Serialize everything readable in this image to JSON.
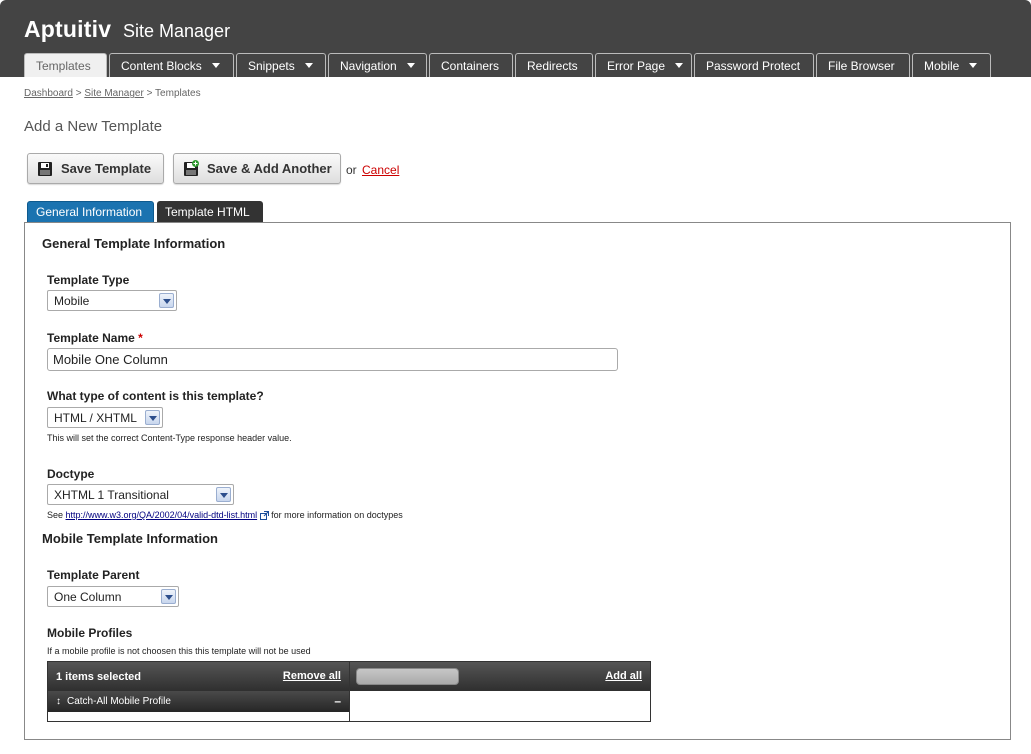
{
  "header": {
    "brand": "Aptuitiv",
    "section": "Site Manager",
    "tabs": [
      {
        "label": "Templates"
      },
      {
        "label": "Content Blocks"
      },
      {
        "label": "Snippets"
      },
      {
        "label": "Navigation"
      },
      {
        "label": "Containers"
      },
      {
        "label": "Redirects"
      },
      {
        "label": "Error Page"
      },
      {
        "label": "Password Protect"
      },
      {
        "label": "File Browser"
      },
      {
        "label": "Mobile"
      }
    ]
  },
  "breadcrumb": {
    "items": [
      "Dashboard",
      "Site Manager",
      "Templates"
    ],
    "separator": ">"
  },
  "page_title": "Add a New Template",
  "actions": {
    "save": "Save Template",
    "save_add": "Save & Add Another",
    "or": "or",
    "cancel": "Cancel"
  },
  "form_tabs": [
    "General Information",
    "Template HTML"
  ],
  "general": {
    "heading": "General Template Information",
    "template_type": {
      "label": "Template Type",
      "value": "Mobile"
    },
    "template_name": {
      "label": "Template Name",
      "required_mark": "*",
      "value": "Mobile One Column"
    },
    "content_type": {
      "label": "What type of content is this template?",
      "value": "HTML / XHTML",
      "help": "This will set the correct Content-Type response header value."
    },
    "doctype": {
      "label": "Doctype",
      "value": "XHTML 1 Transitional",
      "help_prefix": "See",
      "help_link": "http://www.w3.org/QA/2002/04/valid-dtd-list.html",
      "help_suffix": "for more information on doctypes"
    }
  },
  "mobile": {
    "heading": "Mobile Template Information",
    "template_parent": {
      "label": "Template Parent",
      "value": "One Column"
    },
    "profiles": {
      "label": "Mobile Profiles",
      "help": "If a mobile profile is not choosen this this template will not be used",
      "selected_count_text": "1 items selected",
      "remove_all": "Remove all",
      "add_all": "Add all",
      "selected": [
        "Catch-All Mobile Profile"
      ],
      "minus": "–",
      "grip": "↕"
    }
  },
  "colors": {
    "header_bg": "#444444",
    "active_tab_blue": "#1b73b0",
    "cancel_red": "#cc0000"
  }
}
